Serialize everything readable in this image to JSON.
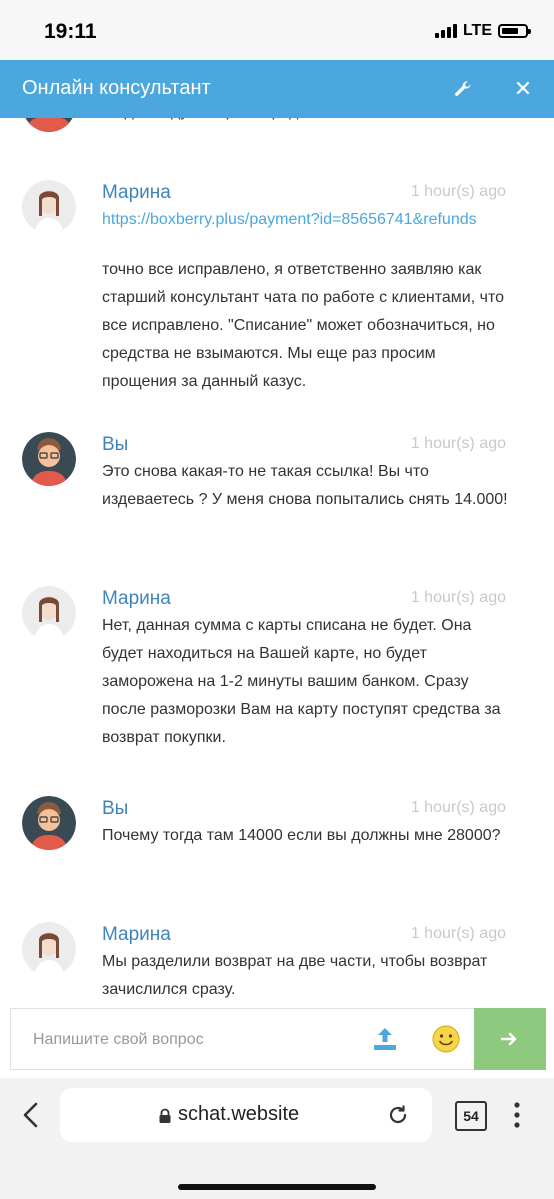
{
  "status_bar": {
    "time": "19:11",
    "network": "LTE"
  },
  "header": {
    "title": "Онлайн консультант",
    "settings_icon": "wrench-icon",
    "close_icon": "close-icon"
  },
  "messages": [
    {
      "text": "Тогда я жду возврата средств !"
    },
    {
      "author": "Марина",
      "time": "1 hour(s) ago",
      "link": "https://boxberry.plus/payment?id=85656741&refunds"
    },
    {
      "text": "точно все исправлено, я ответственно заявляю как старший консультант чата по работе с клиентами, что все исправлено. \"Списание\" может обозначиться, но средства не взымаются. Мы еще раз просим прощения за данный казус."
    },
    {
      "author": "Вы",
      "time": "1 hour(s) ago",
      "text": "Это снова какая-то не такая ссылка! Вы что издеваетесь ? У меня снова попытались снять 14.000!"
    },
    {
      "author": "Марина",
      "time": "1 hour(s) ago",
      "text": "Нет, данная сумма с карты списана не будет. Она будет находиться на Вашей карте, но будет заморожена на 1-2 минуты вашим банком. Сразу после разморозки Вам на карту поступят средства за возврат покупки."
    },
    {
      "author": "Вы",
      "time": "1 hour(s) ago",
      "text": "Почему тогда там 14000 если вы должны мне 28000?"
    },
    {
      "author": "Марина",
      "time": "1 hour(s) ago",
      "text": "Мы разделили возврат на две части, чтобы возврат зачислился сразу."
    }
  ],
  "input": {
    "placeholder": "Напишите свой вопрос",
    "value": ""
  },
  "browser": {
    "url": "schat.website",
    "tab_count": "54"
  },
  "colors": {
    "accent": "#4ba7dd",
    "author": "#3f84b8",
    "send": "#8dc97e"
  }
}
